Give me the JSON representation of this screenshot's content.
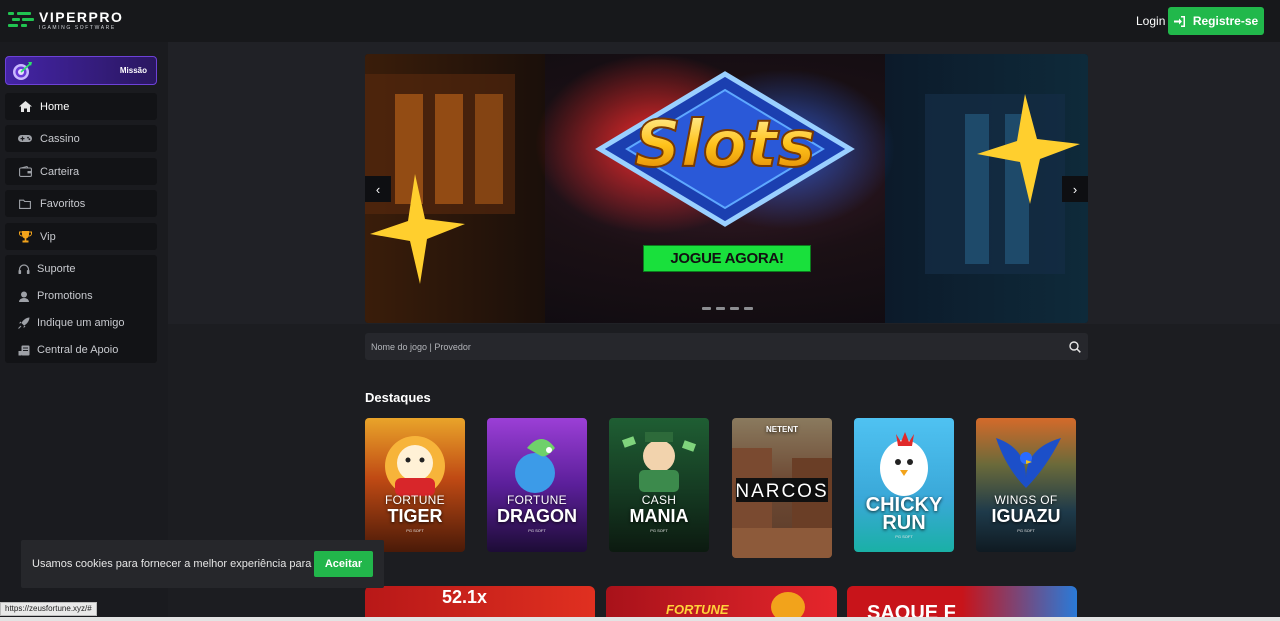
{
  "header": {
    "logo_name": "VIPERPRO",
    "logo_sub": "IGAMING SOFTWARE",
    "login_label": "Login",
    "register_label": "Registre-se"
  },
  "sidebar": {
    "mission_label": "Missão",
    "nav": [
      {
        "label": "Home",
        "icon": "home-icon"
      },
      {
        "label": "Cassino",
        "icon": "gamepad-icon"
      },
      {
        "label": "Carteira",
        "icon": "wallet-icon"
      },
      {
        "label": "Favoritos",
        "icon": "folder-icon"
      },
      {
        "label": "Vip",
        "icon": "trophy-icon"
      }
    ],
    "support": [
      {
        "label": "Suporte",
        "icon": "headset-icon"
      },
      {
        "label": "Promotions",
        "icon": "user-icon"
      },
      {
        "label": "Indique um amigo",
        "icon": "rocket-icon"
      },
      {
        "label": "Central de Apoio",
        "icon": "support-center-icon"
      }
    ]
  },
  "banner": {
    "headline": "Slots",
    "cta_label": "JOGUE AGORA!",
    "slide_count": 4
  },
  "search": {
    "placeholder": "Nome do jogo | Provedor"
  },
  "highlights": {
    "title": "Destaques",
    "games": [
      {
        "line1": "FORTUNE",
        "line2": "TIGER",
        "provider": "PG SOFT"
      },
      {
        "line1": "FORTUNE",
        "line2": "DRAGON",
        "provider": "PG SOFT"
      },
      {
        "line1": "CASH",
        "line2": "MANIA",
        "provider": "PG SOFT"
      },
      {
        "line1": "NETENT",
        "line2": "NARCOS",
        "provider": ""
      },
      {
        "line1": "CHICKY",
        "line2": "RUN",
        "provider": "PG SOFT"
      },
      {
        "line1": "WINGS OF",
        "line2": "IGUAZU",
        "provider": "PG SOFT"
      }
    ]
  },
  "promos": [
    {
      "text": "52.1x"
    },
    {
      "text": "FORTUNE"
    },
    {
      "text": "SAQUE F"
    }
  ],
  "cookie": {
    "message": "Usamos cookies para fornecer a melhor experiência para você.",
    "accept_label": "Aceitar"
  },
  "status_url": "https://zeusfortune.xyz/#",
  "colors": {
    "accent_green": "#21b84b",
    "cta_green": "#19e03c",
    "mission_purple": "#4424a6",
    "background": "#1c1d21"
  }
}
